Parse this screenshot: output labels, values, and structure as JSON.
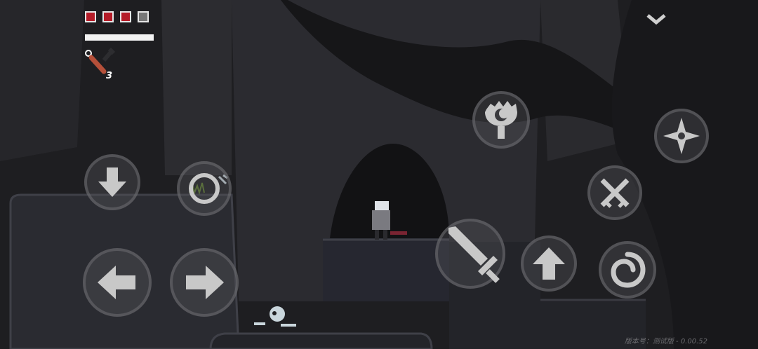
{
  "hud": {
    "health": {
      "current": 3,
      "max": 4
    },
    "stamina_fraction": 1.0,
    "item": {
      "icon": "torch-bomb-icon",
      "count": "3"
    }
  },
  "menu_button": {
    "icon": "chevron-down-icon"
  },
  "controls": {
    "dpad": [
      "arrow-down-icon",
      "arrow-left-icon",
      "arrow-right-icon"
    ],
    "interact": "ring-icon",
    "skill": "moon-shield-icon",
    "throw": "shuriken-icon",
    "parry": "crossed-swords-icon",
    "attack": "sword-icon",
    "jump": "arrow-up-icon",
    "dash": "spiral-icon"
  },
  "version_text": "版本号：测试版 - 0.00.52",
  "colors": {
    "health": "#b51c28",
    "background": "#1d1d20",
    "button_fill": "#c8c8c8"
  }
}
